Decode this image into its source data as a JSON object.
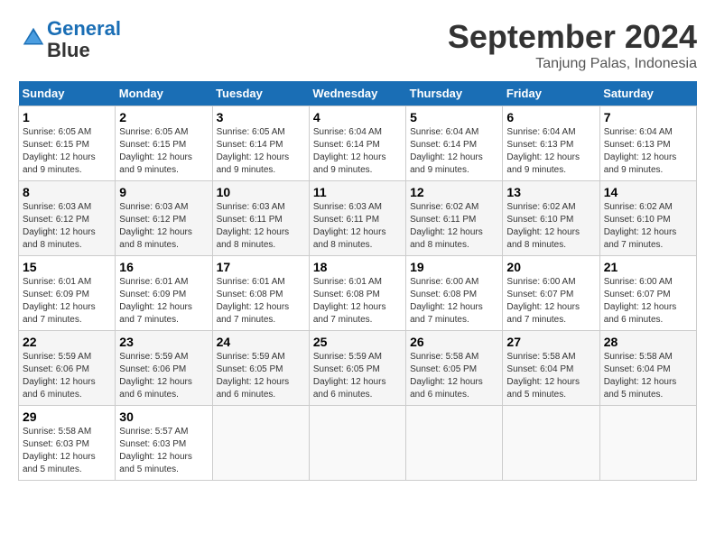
{
  "header": {
    "logo_line1": "General",
    "logo_line2": "Blue",
    "month_title": "September 2024",
    "location": "Tanjung Palas, Indonesia"
  },
  "days_of_week": [
    "Sunday",
    "Monday",
    "Tuesday",
    "Wednesday",
    "Thursday",
    "Friday",
    "Saturday"
  ],
  "weeks": [
    [
      {
        "day": 1,
        "sunrise": "6:05 AM",
        "sunset": "6:15 PM",
        "daylight": "12 hours and 9 minutes."
      },
      {
        "day": 2,
        "sunrise": "6:05 AM",
        "sunset": "6:15 PM",
        "daylight": "12 hours and 9 minutes."
      },
      {
        "day": 3,
        "sunrise": "6:05 AM",
        "sunset": "6:14 PM",
        "daylight": "12 hours and 9 minutes."
      },
      {
        "day": 4,
        "sunrise": "6:04 AM",
        "sunset": "6:14 PM",
        "daylight": "12 hours and 9 minutes."
      },
      {
        "day": 5,
        "sunrise": "6:04 AM",
        "sunset": "6:14 PM",
        "daylight": "12 hours and 9 minutes."
      },
      {
        "day": 6,
        "sunrise": "6:04 AM",
        "sunset": "6:13 PM",
        "daylight": "12 hours and 9 minutes."
      },
      {
        "day": 7,
        "sunrise": "6:04 AM",
        "sunset": "6:13 PM",
        "daylight": "12 hours and 9 minutes."
      }
    ],
    [
      {
        "day": 8,
        "sunrise": "6:03 AM",
        "sunset": "6:12 PM",
        "daylight": "12 hours and 8 minutes."
      },
      {
        "day": 9,
        "sunrise": "6:03 AM",
        "sunset": "6:12 PM",
        "daylight": "12 hours and 8 minutes."
      },
      {
        "day": 10,
        "sunrise": "6:03 AM",
        "sunset": "6:11 PM",
        "daylight": "12 hours and 8 minutes."
      },
      {
        "day": 11,
        "sunrise": "6:03 AM",
        "sunset": "6:11 PM",
        "daylight": "12 hours and 8 minutes."
      },
      {
        "day": 12,
        "sunrise": "6:02 AM",
        "sunset": "6:11 PM",
        "daylight": "12 hours and 8 minutes."
      },
      {
        "day": 13,
        "sunrise": "6:02 AM",
        "sunset": "6:10 PM",
        "daylight": "12 hours and 8 minutes."
      },
      {
        "day": 14,
        "sunrise": "6:02 AM",
        "sunset": "6:10 PM",
        "daylight": "12 hours and 7 minutes."
      }
    ],
    [
      {
        "day": 15,
        "sunrise": "6:01 AM",
        "sunset": "6:09 PM",
        "daylight": "12 hours and 7 minutes."
      },
      {
        "day": 16,
        "sunrise": "6:01 AM",
        "sunset": "6:09 PM",
        "daylight": "12 hours and 7 minutes."
      },
      {
        "day": 17,
        "sunrise": "6:01 AM",
        "sunset": "6:08 PM",
        "daylight": "12 hours and 7 minutes."
      },
      {
        "day": 18,
        "sunrise": "6:01 AM",
        "sunset": "6:08 PM",
        "daylight": "12 hours and 7 minutes."
      },
      {
        "day": 19,
        "sunrise": "6:00 AM",
        "sunset": "6:08 PM",
        "daylight": "12 hours and 7 minutes."
      },
      {
        "day": 20,
        "sunrise": "6:00 AM",
        "sunset": "6:07 PM",
        "daylight": "12 hours and 7 minutes."
      },
      {
        "day": 21,
        "sunrise": "6:00 AM",
        "sunset": "6:07 PM",
        "daylight": "12 hours and 6 minutes."
      }
    ],
    [
      {
        "day": 22,
        "sunrise": "5:59 AM",
        "sunset": "6:06 PM",
        "daylight": "12 hours and 6 minutes."
      },
      {
        "day": 23,
        "sunrise": "5:59 AM",
        "sunset": "6:06 PM",
        "daylight": "12 hours and 6 minutes."
      },
      {
        "day": 24,
        "sunrise": "5:59 AM",
        "sunset": "6:05 PM",
        "daylight": "12 hours and 6 minutes."
      },
      {
        "day": 25,
        "sunrise": "5:59 AM",
        "sunset": "6:05 PM",
        "daylight": "12 hours and 6 minutes."
      },
      {
        "day": 26,
        "sunrise": "5:58 AM",
        "sunset": "6:05 PM",
        "daylight": "12 hours and 6 minutes."
      },
      {
        "day": 27,
        "sunrise": "5:58 AM",
        "sunset": "6:04 PM",
        "daylight": "12 hours and 5 minutes."
      },
      {
        "day": 28,
        "sunrise": "5:58 AM",
        "sunset": "6:04 PM",
        "daylight": "12 hours and 5 minutes."
      }
    ],
    [
      {
        "day": 29,
        "sunrise": "5:58 AM",
        "sunset": "6:03 PM",
        "daylight": "12 hours and 5 minutes."
      },
      {
        "day": 30,
        "sunrise": "5:57 AM",
        "sunset": "6:03 PM",
        "daylight": "12 hours and 5 minutes."
      },
      null,
      null,
      null,
      null,
      null
    ]
  ]
}
